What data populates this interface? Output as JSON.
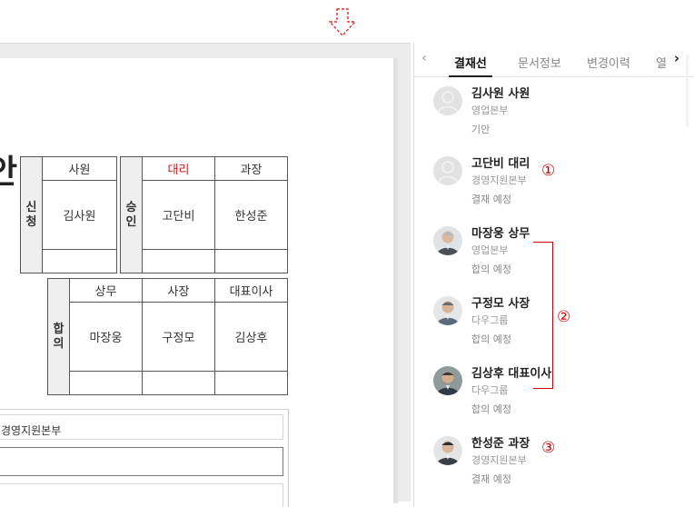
{
  "document": {
    "title_char": "안",
    "application": {
      "side_label": "신청",
      "position": "사원",
      "name": "김사원"
    },
    "approval": {
      "side_label": "승인",
      "columns": [
        {
          "position": "대리",
          "name": "고단비"
        },
        {
          "position": "과장",
          "name": "한성준"
        }
      ]
    },
    "agreement": {
      "side_label": "합의",
      "columns": [
        {
          "position": "상무",
          "name": "마장웅"
        },
        {
          "position": "사장",
          "name": "구정모"
        },
        {
          "position": "대표이사",
          "name": "김상후"
        }
      ]
    },
    "department_field": "경영지원본부"
  },
  "panel": {
    "tabs": [
      "결재선",
      "문서정보",
      "변경이력",
      "열"
    ],
    "active_tab": "결재선",
    "people": [
      {
        "name": "김사원 사원",
        "dept": "영업본부",
        "status": "기안"
      },
      {
        "name": "고단비 대리",
        "dept": "경영지원본부",
        "status": "결재 예정"
      },
      {
        "name": "마장웅 상무",
        "dept": "영업본부",
        "status": "합의 예정"
      },
      {
        "name": "구정모 사장",
        "dept": "다우그룹",
        "status": "합의 예정"
      },
      {
        "name": "김상후 대표이사",
        "dept": "다우그룹",
        "status": "합의 예정"
      },
      {
        "name": "한성준 과장",
        "dept": "경영지원본부",
        "status": "결재 예정"
      }
    ]
  },
  "annotations": {
    "marker_1": "①",
    "marker_2": "②",
    "marker_3": "③"
  },
  "colors": {
    "annotation_red": "#d00000",
    "header_red": "#d02020"
  }
}
